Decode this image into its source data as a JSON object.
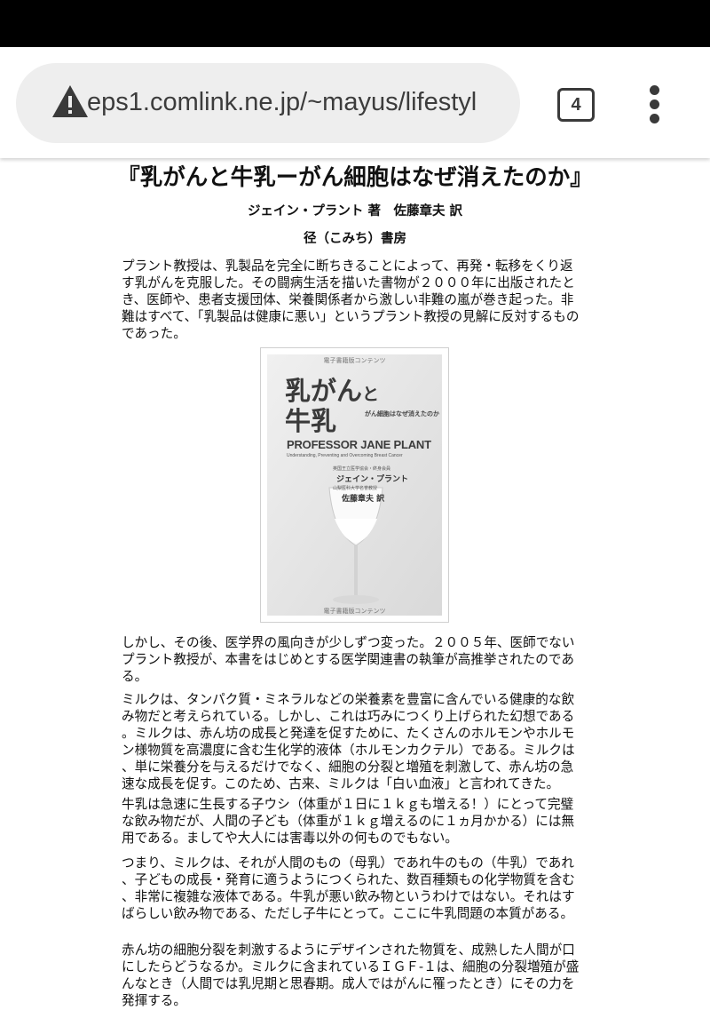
{
  "browser": {
    "url": "eps1.comlink.ne.jp/~mayus/lifestyl",
    "tab_count": "4",
    "icons": {
      "security": "warning-triangle-icon",
      "tabs": "tab-switcher-icon",
      "menu": "vertical-dots-menu-icon"
    }
  },
  "article": {
    "title": "『乳がんと牛乳ーがん細胞はなぜ消えたのか』",
    "author_line": "ジェイン・プラント 著　佐藤章夫 訳",
    "publisher": "径（こみち）書房",
    "paragraphs": [
      "プラント教授は、乳製品を完全に断ちきることによって、再発・転移をくり返す乳がんを克服した。その闘病生活を描いた書物が２０００年に出版されたとき、医師や、患者支援団体、栄養関係者から激しい非難の嵐が巻き起った。非難はすべて、「乳製品は健康に悪い」というプラント教授の見解に反対するものであった。",
      "しかし、その後、医学界の風向きが少しずつ変った。２００５年、医師でないプラント教授が、本書をはじめとする医学関連書の執筆が高推挙されたのである。",
      "ミルクは、タンパク質・ミネラルなどの栄養素を豊富に含んでいる健康的な飲み物だと考えられている。しかし、これは巧みにつくり上げられた幻想である。ミルクは、赤ん坊の成長と発達を促すために、たくさんのホルモンやホルモン様物質を高濃度に含む生化学的液体（ホルモンカクテル）である。ミルクは、単に栄養分を与えるだけでなく、細胞の分裂と増殖を刺激して、赤ん坊の急速な成長を促す。このため、古来、ミルクは「白い血液」と言われてきた。",
      "牛乳は急速に生長する子ウシ（体重が１日に１ｋｇも増える！）にとって完璧な飲み物だが、人間の子ども（体重が１ｋｇ増えるのに１ヵ月かかる）には無用である。ましてや大人には害毒以外の何ものでもない。",
      "つまり、ミルクは、それが人間のもの（母乳）であれ牛のもの（牛乳）であれ、子どもの成長・発育に適うようにつくられた、数百種類もの化学物質を含む、非常に複雑な液体である。牛乳が悪い飲み物というわけではない。それはすばらしい飲み物である、ただし子牛にとって。ここに牛乳問題の本質がある。",
      "赤ん坊の細胞分裂を刺激するようにデザインされた物質を、成熟した人間が口にしたらどうなるか。ミルクに含まれているＩＧＦ-１は、細胞の分裂増殖が盛んなとき（人間では乳児期と思春期。成人ではがんに罹ったとき）にその力を発揮する。"
    ]
  },
  "book_cover": {
    "top_note": "電子書籍版コンテンツ",
    "title_line1_a": "乳がん",
    "title_line1_b": "と",
    "title_line2": "牛乳",
    "subtitle": "がん細胞はなぜ消えたのか",
    "english_title": "PROFESSOR JANE PLANT",
    "english_subtitle": "Understanding, Preventing and Overcoming Breast Cancer",
    "author_role": "英国王立医学協会・終身会員",
    "author": "ジェイン・プラント",
    "translator_role": "山梨医科大学名誉教授",
    "translator": "佐藤章夫 訳",
    "bottom_note": "電子書籍版コンテンツ"
  }
}
